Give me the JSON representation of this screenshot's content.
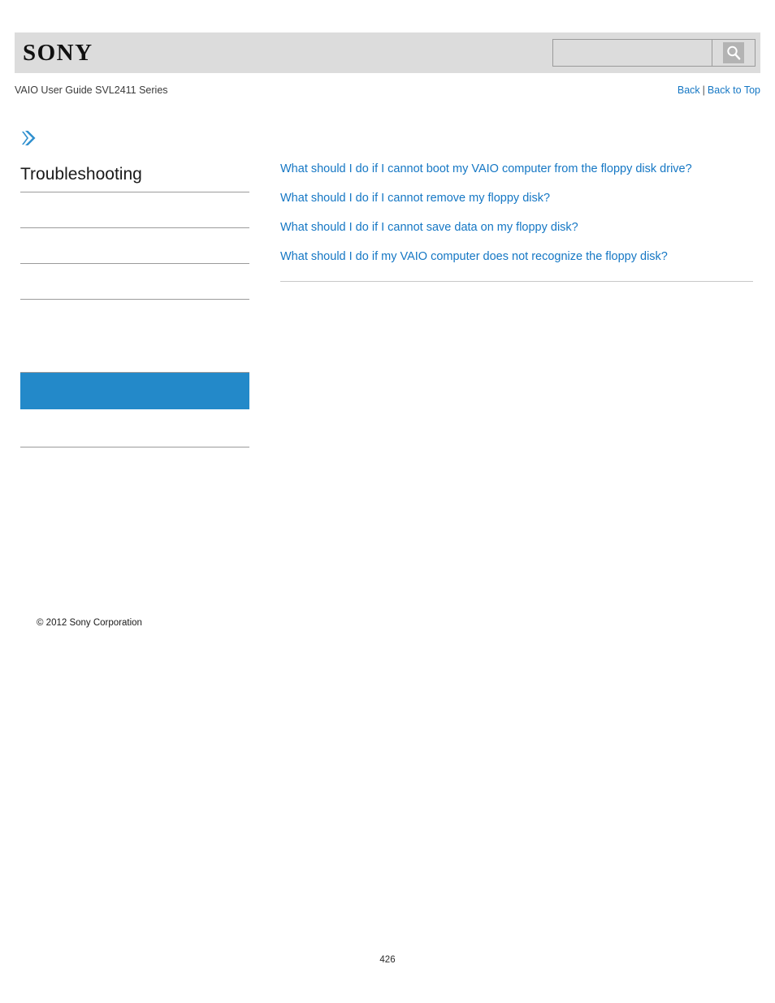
{
  "header": {
    "logo_text": "SONY",
    "logo_icon": "sony-wordmark",
    "search": {
      "value": "",
      "placeholder": "",
      "icon": "search-icon"
    }
  },
  "subheader": {
    "guide_title": "VAIO User Guide SVL2411 Series",
    "back_label": "Back",
    "separator": "|",
    "back_to_top_label": "Back to Top"
  },
  "sidebar": {
    "breadcrumb_icon": "chevron-right-icon",
    "section_title": "Troubleshooting",
    "items": [
      {
        "label": "",
        "selected": false
      },
      {
        "label": "",
        "selected": false
      },
      {
        "label": "",
        "selected": false
      },
      {
        "label": "",
        "selected": false
      },
      {
        "label": "",
        "selected": true
      },
      {
        "label": "",
        "selected": false
      }
    ],
    "copyright": "© 2012 Sony Corporation"
  },
  "main": {
    "links": [
      "What should I do if I cannot boot my VAIO computer from the floppy disk drive?",
      "What should I do if I cannot remove my floppy disk?",
      "What should I do if I cannot save data on my floppy disk?",
      "What should I do if my VAIO computer does not recognize the floppy disk?"
    ]
  },
  "footer": {
    "page_number": "426"
  },
  "colors": {
    "link": "#1577c4",
    "selected_bg": "#2389c9",
    "header_bg": "#dcdcdc",
    "rule": "#9b9b9b"
  }
}
